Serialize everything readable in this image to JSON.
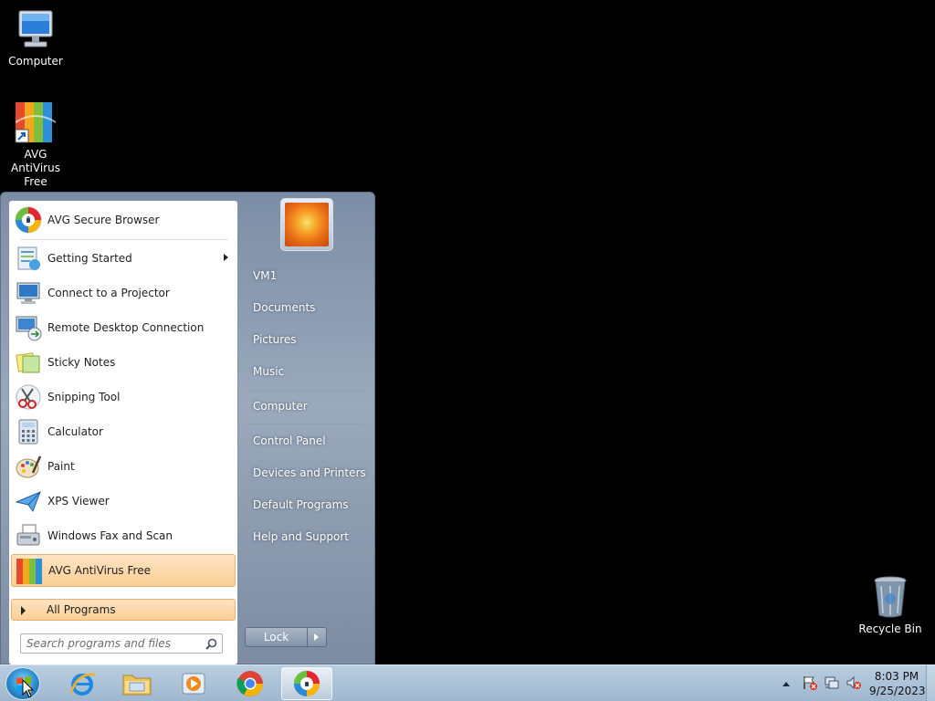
{
  "desktop": {
    "icons": [
      {
        "label": "Computer",
        "icon": "computer-icon"
      },
      {
        "label": "AVG AntiVirus Free",
        "icon": "avg-antivirus-icon"
      },
      {
        "label": "Recycle Bin",
        "icon": "recycle-bin-icon"
      }
    ]
  },
  "start_menu": {
    "pinned": [
      {
        "label": "AVG Secure Browser",
        "icon": "avg-secure-browser-icon"
      }
    ],
    "recent": [
      {
        "label": "Getting Started",
        "icon": "getting-started-icon",
        "has_submenu": true
      },
      {
        "label": "Connect to a Projector",
        "icon": "projector-icon"
      },
      {
        "label": "Remote Desktop Connection",
        "icon": "remote-desktop-icon"
      },
      {
        "label": "Sticky Notes",
        "icon": "sticky-notes-icon"
      },
      {
        "label": "Snipping Tool",
        "icon": "snipping-tool-icon"
      },
      {
        "label": "Calculator",
        "icon": "calculator-icon"
      },
      {
        "label": "Paint",
        "icon": "paint-icon"
      },
      {
        "label": "XPS Viewer",
        "icon": "xps-viewer-icon"
      },
      {
        "label": "Windows Fax and Scan",
        "icon": "fax-scan-icon"
      },
      {
        "label": "AVG AntiVirus Free",
        "icon": "avg-antivirus-icon",
        "highlighted": true
      }
    ],
    "all_programs": "All Programs",
    "search_placeholder": "Search programs and files",
    "right_items": [
      {
        "label": "VM1"
      },
      {
        "label": "Documents"
      },
      {
        "label": "Pictures"
      },
      {
        "label": "Music"
      },
      {
        "label": "Computer"
      },
      {
        "label": "Control Panel"
      },
      {
        "label": "Devices and Printers"
      },
      {
        "label": "Default Programs"
      },
      {
        "label": "Help and Support"
      }
    ],
    "lock_label": "Lock"
  },
  "taskbar": {
    "apps": [
      {
        "name": "internet-explorer-icon"
      },
      {
        "name": "file-explorer-icon"
      },
      {
        "name": "media-player-icon"
      },
      {
        "name": "chrome-icon"
      },
      {
        "name": "avg-secure-browser-icon",
        "active": true
      }
    ],
    "time": "8:03 PM",
    "date": "9/25/2023"
  }
}
